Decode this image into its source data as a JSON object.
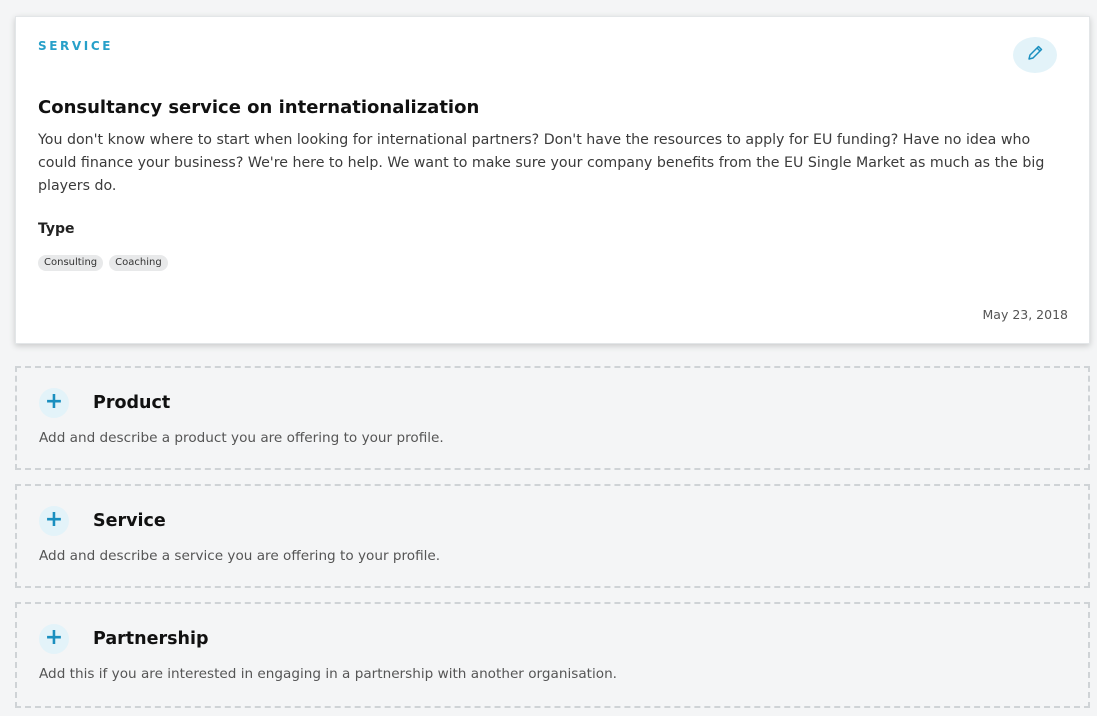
{
  "service_card": {
    "kind": "SERVICE",
    "title": "Consultancy service on internationalization",
    "description": "You don't know where to start when looking for international partners? Don't have the resources to apply for EU funding? Have no idea who could finance your business? We're here to help. We want to make sure your company benefits from the EU Single Market as much as the big players do.",
    "type_label": "Type",
    "tags": [
      "Consulting",
      "Coaching"
    ],
    "date": "May 23, 2018",
    "edit_icon": "pencil-icon",
    "accent_color": "#27a0c9"
  },
  "add_sections": [
    {
      "icon": "plus-icon",
      "title": "Product",
      "hint": "Add and describe a product you are offering to your profile."
    },
    {
      "icon": "plus-icon",
      "title": "Service",
      "hint": "Add and describe a service you are offering to your profile."
    },
    {
      "icon": "plus-icon",
      "title": "Partnership",
      "hint": "Add this if you are interested in engaging in a partnership with another organisation."
    }
  ]
}
